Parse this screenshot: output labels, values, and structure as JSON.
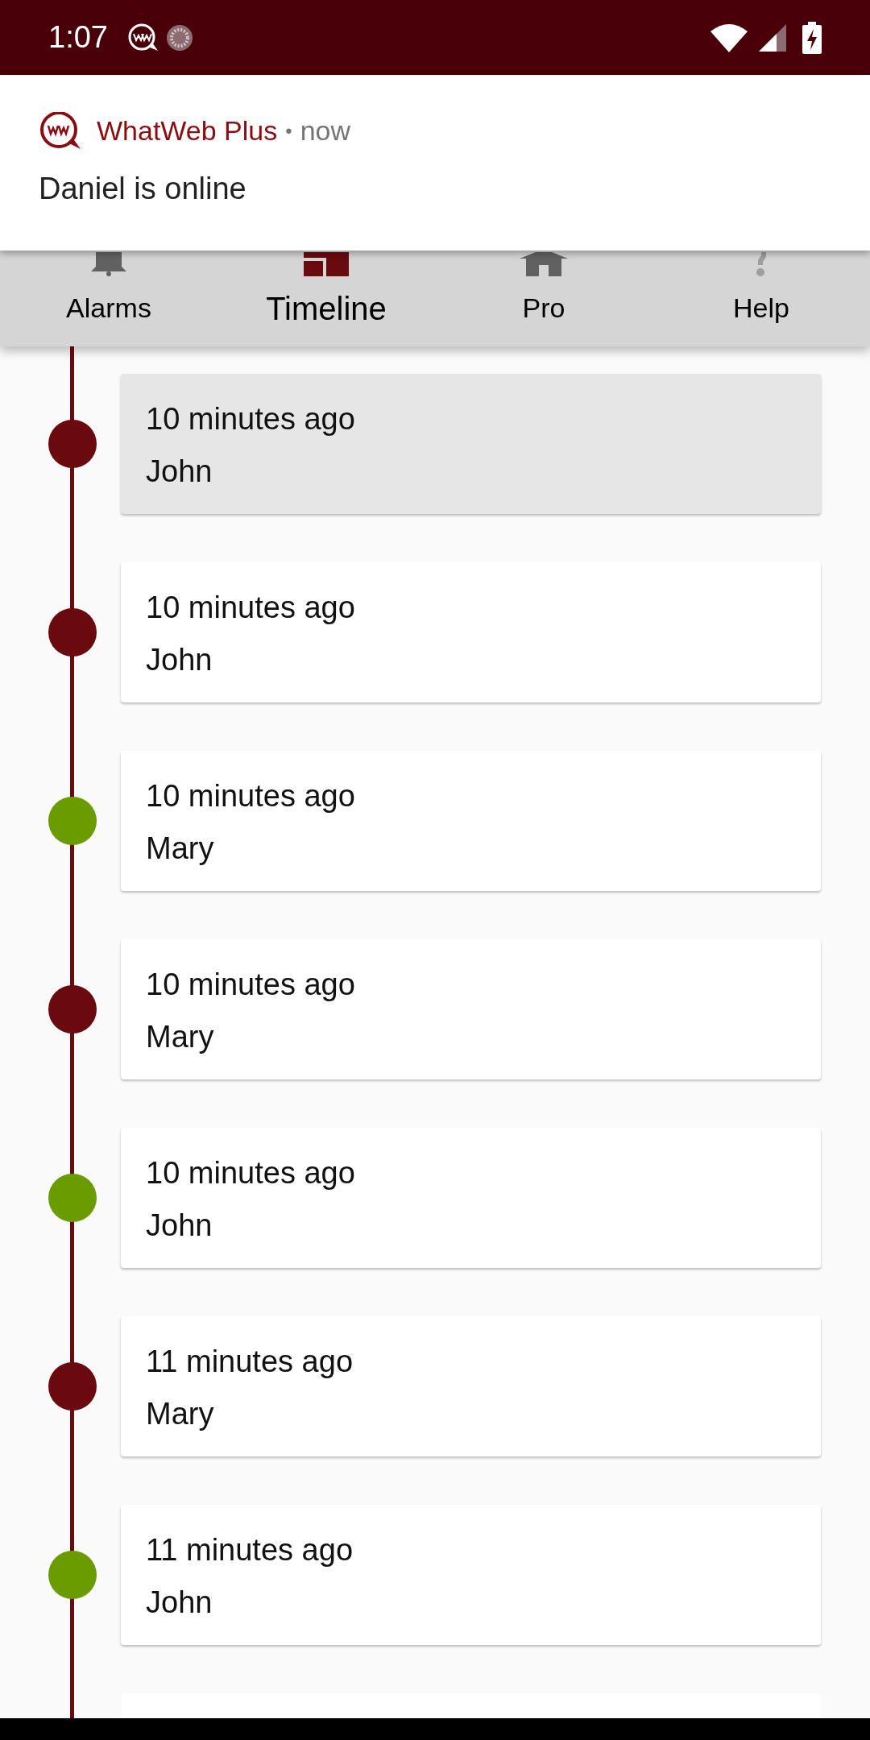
{
  "status_bar": {
    "time": "1:07"
  },
  "notification": {
    "app": "WhatWeb Plus",
    "separator": "•",
    "time": "now",
    "message": "Daniel is online"
  },
  "tabs": [
    {
      "label": "Alarms",
      "kind": "bell",
      "selected": false
    },
    {
      "label": "Timeline",
      "kind": "timeline",
      "selected": true
    },
    {
      "label": "Pro",
      "kind": "home",
      "selected": false
    },
    {
      "label": "Help",
      "kind": "help",
      "selected": false
    }
  ],
  "timeline": [
    {
      "time": "10 minutes ago",
      "name": "John",
      "color": "#6b0a0e"
    },
    {
      "time": "10 minutes ago",
      "name": "John",
      "color": "#6b0a0e"
    },
    {
      "time": "10 minutes ago",
      "name": "Mary",
      "color": "#6a9c00"
    },
    {
      "time": "10 minutes ago",
      "name": "Mary",
      "color": "#6b0a0e"
    },
    {
      "time": "10 minutes ago",
      "name": "John",
      "color": "#6a9c00"
    },
    {
      "time": "11 minutes ago",
      "name": "Mary",
      "color": "#6b0a0e"
    },
    {
      "time": "11 minutes ago",
      "name": "John",
      "color": "#6a9c00"
    }
  ]
}
